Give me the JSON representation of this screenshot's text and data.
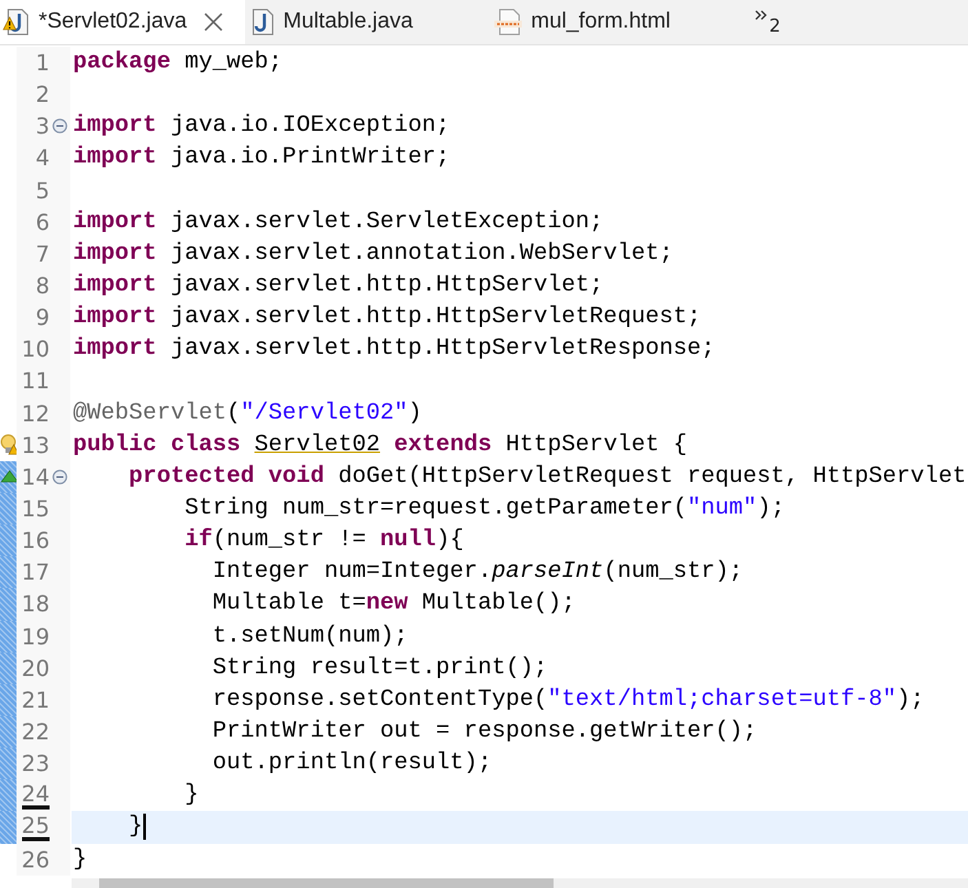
{
  "tabs": [
    {
      "label": "*Servlet02.java",
      "kind": "java",
      "warning": true,
      "selected": true
    },
    {
      "label": "Multable.java",
      "kind": "java",
      "warning": false,
      "selected": false
    },
    {
      "label": "mul_form.html",
      "kind": "html",
      "warning": false,
      "selected": false
    }
  ],
  "overflow": {
    "count": "2"
  },
  "lines": [
    {
      "number": "1",
      "segments": [
        {
          "keyword": "package"
        },
        {
          "text": " my_web;"
        }
      ]
    },
    {
      "number": "2"
    },
    {
      "number": "3",
      "fold": true,
      "segments": [
        {
          "keyword": "import"
        },
        {
          "text": " java.io.IOException;"
        }
      ]
    },
    {
      "number": "4",
      "segments": [
        {
          "keyword": "import"
        },
        {
          "text": " java.io.PrintWriter;"
        }
      ]
    },
    {
      "number": "5"
    },
    {
      "number": "6",
      "segments": [
        {
          "keyword": "import"
        },
        {
          "text": " javax.servlet.ServletException;"
        }
      ]
    },
    {
      "number": "7",
      "segments": [
        {
          "keyword": "import"
        },
        {
          "text": " javax.servlet.annotation.WebServlet;"
        }
      ]
    },
    {
      "number": "8",
      "segments": [
        {
          "keyword": "import"
        },
        {
          "text": " javax.servlet.http.HttpServlet;"
        }
      ]
    },
    {
      "number": "9",
      "segments": [
        {
          "keyword": "import"
        },
        {
          "text": " javax.servlet.http.HttpServletRequest;"
        }
      ]
    },
    {
      "number": "10",
      "segments": [
        {
          "keyword": "import"
        },
        {
          "text": " javax.servlet.http.HttpServletResponse;"
        }
      ]
    },
    {
      "number": "11"
    },
    {
      "number": "12",
      "segments": [
        {
          "annotation": "@WebServlet"
        },
        {
          "text": "("
        },
        {
          "string": "\"/Servlet02\""
        },
        {
          "text": ")"
        }
      ]
    },
    {
      "number": "13",
      "warning": true,
      "segments": [
        {
          "keyword": "public class "
        },
        {
          "warned": "Servlet02"
        },
        {
          "keyword": " extends"
        },
        {
          "text": " HttpServlet {"
        }
      ]
    },
    {
      "number": "14",
      "override": true,
      "fold": true,
      "changed": true,
      "segments": [
        {
          "keyword": "    protected void"
        },
        {
          "text": " doGet(HttpServletRequest request, HttpServlet"
        }
      ]
    },
    {
      "number": "15",
      "changed": true,
      "segments": [
        {
          "text": "        String num_str=request.getParameter("
        },
        {
          "string": "\"num\""
        },
        {
          "text": ");"
        }
      ]
    },
    {
      "number": "16",
      "changed": true,
      "segments": [
        {
          "keyword": "        if"
        },
        {
          "text": "(num_str != "
        },
        {
          "keyword": "null"
        },
        {
          "text": "){"
        }
      ]
    },
    {
      "number": "17",
      "changed": true,
      "segments": [
        {
          "text": "          Integer num=Integer."
        },
        {
          "static_call": "parseInt"
        },
        {
          "text": "(num_str);"
        }
      ]
    },
    {
      "number": "18",
      "changed": true,
      "segments": [
        {
          "text": "          Multable t="
        },
        {
          "keyword": "new"
        },
        {
          "text": " Multable();"
        }
      ]
    },
    {
      "number": "19",
      "changed": true,
      "segments": [
        {
          "text": "          t.setNum(num);"
        }
      ]
    },
    {
      "number": "20",
      "changed": true,
      "segments": [
        {
          "text": "          String result=t.print();"
        }
      ]
    },
    {
      "number": "21",
      "changed": true,
      "segments": [
        {
          "text": "          response.setContentType("
        },
        {
          "string": "\"text/html;charset=utf-8\""
        },
        {
          "text": ");"
        }
      ]
    },
    {
      "number": "22",
      "changed": true,
      "segments": [
        {
          "text": "          PrintWriter out = response.getWriter();"
        }
      ]
    },
    {
      "number": "23",
      "changed": true,
      "segments": [
        {
          "text": "          out.println(result);"
        }
      ]
    },
    {
      "number": "24",
      "changed": true,
      "deletion": true,
      "segments": [
        {
          "text": "        }"
        }
      ]
    },
    {
      "number": "25",
      "changed": true,
      "deletion": true,
      "current": true,
      "segments": [
        {
          "text": "    }"
        }
      ]
    },
    {
      "number": "26",
      "segments": [
        {
          "text": "}"
        }
      ]
    }
  ]
}
